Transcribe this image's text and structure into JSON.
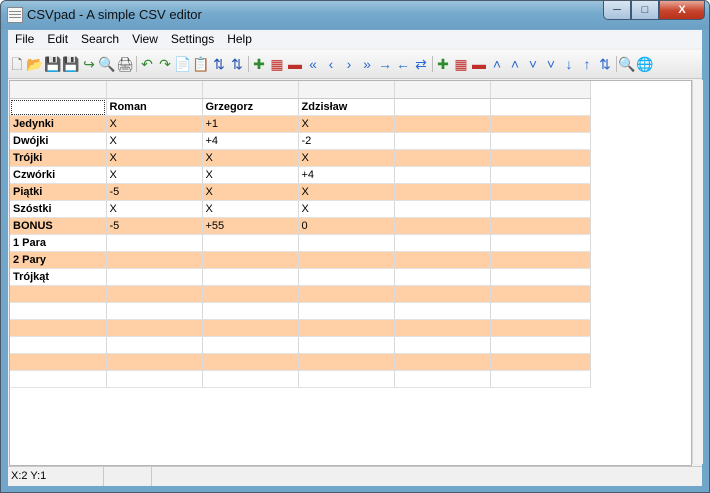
{
  "window": {
    "title": "CSVpad - A simple CSV editor",
    "minimize": "─",
    "maximize": "□",
    "close": "X"
  },
  "menu": [
    "File",
    "Edit",
    "Search",
    "View",
    "Settings",
    "Help"
  ],
  "toolbar": {
    "groups": [
      [
        {
          "name": "new-file-icon",
          "glyph": "🗋",
          "color": "#6a6a6a"
        },
        {
          "name": "open-folder-icon",
          "glyph": "📂",
          "color": "#c99a2e"
        },
        {
          "name": "save-icon",
          "glyph": "💾",
          "color": "#3b62a8"
        },
        {
          "name": "save-as-icon",
          "glyph": "💾",
          "color": "#3b62a8"
        },
        {
          "name": "export-icon",
          "glyph": "↪",
          "color": "#3a8a3a"
        },
        {
          "name": "print-preview-icon",
          "glyph": "🔍",
          "color": "#555"
        },
        {
          "name": "print-icon",
          "glyph": "🖨",
          "color": "#555"
        }
      ],
      [
        {
          "name": "undo-icon",
          "glyph": "↶",
          "color": "#2f8a2f"
        },
        {
          "name": "redo-icon",
          "glyph": "↷",
          "color": "#2f8a2f"
        },
        {
          "name": "copy-icon",
          "glyph": "📄",
          "color": "#555"
        },
        {
          "name": "paste-icon",
          "glyph": "📋",
          "color": "#9a7a3a"
        },
        {
          "name": "sort-ascending-icon",
          "glyph": "⇅",
          "color": "#2a55b0"
        },
        {
          "name": "sort-descending-icon",
          "glyph": "⇅",
          "color": "#2a55b0"
        }
      ],
      [
        {
          "name": "add-column-icon",
          "glyph": "✚",
          "color": "#2e8b2e"
        },
        {
          "name": "insert-column-icon",
          "glyph": "▦",
          "color": "#c0302a"
        },
        {
          "name": "delete-column-icon",
          "glyph": "▬",
          "color": "#c0302a"
        },
        {
          "name": "move-first-column-icon",
          "glyph": "«",
          "color": "#2a6ad0"
        },
        {
          "name": "move-left-column-icon",
          "glyph": "‹",
          "color": "#2a6ad0"
        },
        {
          "name": "move-right-column-icon",
          "glyph": "›",
          "color": "#2a6ad0"
        },
        {
          "name": "move-last-column-icon",
          "glyph": "»",
          "color": "#2a6ad0"
        },
        {
          "name": "arrow-right-icon",
          "glyph": "→",
          "color": "#2a6ad0"
        },
        {
          "name": "arrow-left-icon",
          "glyph": "←",
          "color": "#2a6ad0"
        },
        {
          "name": "swap-columns-icon",
          "glyph": "⇄",
          "color": "#2a6ad0"
        }
      ],
      [
        {
          "name": "add-row-icon",
          "glyph": "✚",
          "color": "#2e8b2e"
        },
        {
          "name": "insert-row-icon",
          "glyph": "▦",
          "color": "#c0302a"
        },
        {
          "name": "delete-row-icon",
          "glyph": "▬",
          "color": "#c0302a"
        },
        {
          "name": "move-top-row-icon",
          "glyph": "˄",
          "color": "#2a6ad0"
        },
        {
          "name": "move-up-row-icon",
          "glyph": "˄",
          "color": "#2a6ad0"
        },
        {
          "name": "move-down-row-icon",
          "glyph": "˅",
          "color": "#2a6ad0"
        },
        {
          "name": "move-bottom-row-icon",
          "glyph": "˅",
          "color": "#2a6ad0"
        },
        {
          "name": "arrow-down-icon",
          "glyph": "↓",
          "color": "#2a6ad0"
        },
        {
          "name": "arrow-up-icon",
          "glyph": "↑",
          "color": "#2a6ad0"
        },
        {
          "name": "swap-rows-icon",
          "glyph": "⇅",
          "color": "#2a6ad0"
        }
      ],
      [
        {
          "name": "search-icon",
          "glyph": "🔍",
          "color": "#555"
        },
        {
          "name": "globe-icon",
          "glyph": "🌐",
          "color": "#2a6a9a"
        }
      ]
    ]
  },
  "grid": {
    "header": [
      "",
      "",
      "",
      "",
      "",
      ""
    ],
    "rows": [
      [
        "",
        "Roman",
        "Grzegorz",
        "Zdzisław",
        "",
        ""
      ],
      [
        "Jedynki",
        "X",
        "+1",
        "X",
        "",
        ""
      ],
      [
        "Dwójki",
        "X",
        "+4",
        "-2",
        "",
        ""
      ],
      [
        "Trójki",
        "X",
        "X",
        "X",
        "",
        ""
      ],
      [
        "Czwórki",
        "X",
        "X",
        "+4",
        "",
        ""
      ],
      [
        "Piątki",
        "-5",
        "X",
        "X",
        "",
        ""
      ],
      [
        "Szóstki",
        "X",
        "X",
        "X",
        "",
        ""
      ],
      [
        "BONUS",
        "-5",
        "+55",
        "0",
        "",
        ""
      ],
      [
        "1 Para",
        "",
        "",
        "",
        "",
        ""
      ],
      [
        "2 Pary",
        "",
        "",
        "",
        "",
        ""
      ],
      [
        "Trójkąt",
        "",
        "",
        "",
        "",
        ""
      ],
      [
        "",
        "",
        "",
        "",
        "",
        ""
      ],
      [
        "",
        "",
        "",
        "",
        "",
        ""
      ],
      [
        "",
        "",
        "",
        "",
        "",
        ""
      ],
      [
        "",
        "",
        "",
        "",
        "",
        ""
      ],
      [
        "",
        "",
        "",
        "",
        "",
        ""
      ],
      [
        "",
        "",
        "",
        "",
        "",
        ""
      ]
    ],
    "colors": {
      "odd_row": "#ffd0a6",
      "even_row": "#ffffff"
    }
  },
  "status": {
    "position": "X:2  Y:1",
    "panel2": "",
    "panel3": ""
  }
}
